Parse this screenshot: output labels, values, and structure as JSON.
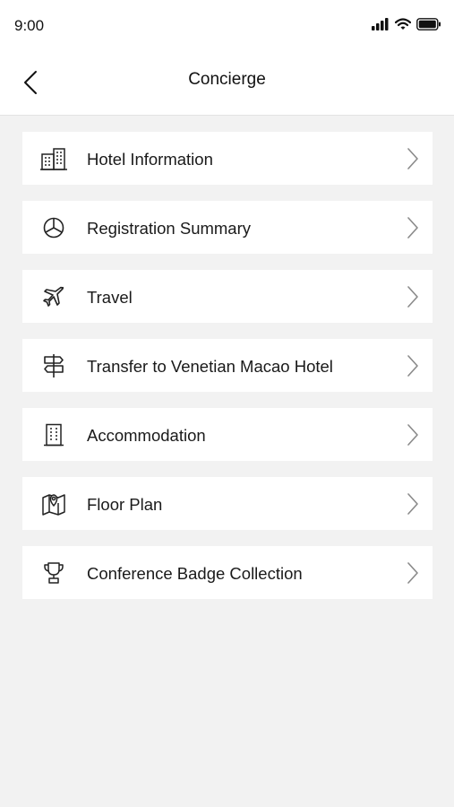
{
  "status_bar": {
    "time": "9:00",
    "icons": [
      "signal-icon",
      "wifi-icon",
      "battery-icon"
    ]
  },
  "header": {
    "title": "Concierge",
    "back_icon": "chevron-left-icon"
  },
  "menu": {
    "items": [
      {
        "label": "Hotel Information",
        "icon": "hotel-buildings-icon"
      },
      {
        "label": "Registration Summary",
        "icon": "pie-chart-icon"
      },
      {
        "label": "Travel",
        "icon": "airplane-icon"
      },
      {
        "label": "Transfer to Venetian Macao Hotel",
        "icon": "signpost-icon"
      },
      {
        "label": "Accommodation",
        "icon": "building-icon"
      },
      {
        "label": "Floor Plan",
        "icon": "map-pin-icon"
      },
      {
        "label": "Conference Badge Collection",
        "icon": "trophy-icon"
      }
    ]
  },
  "colors": {
    "background": "#f2f2f2",
    "card": "#ffffff",
    "text": "#1a1a1a",
    "chevron": "#8a8a8a"
  }
}
